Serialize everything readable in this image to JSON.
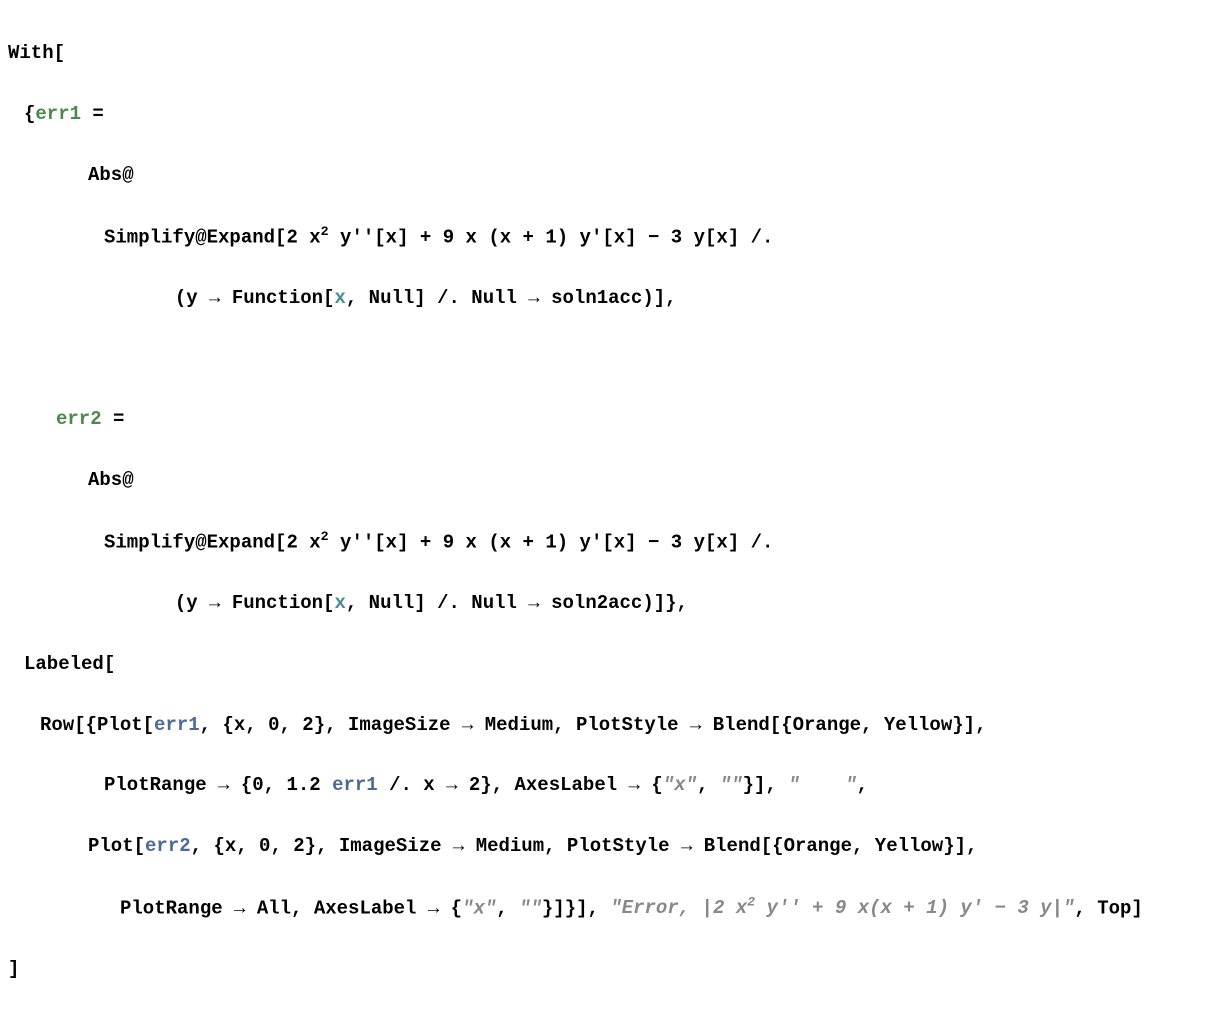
{
  "line1": {
    "p1": "With",
    "p2": "["
  },
  "line2": {
    "p1": "{",
    "var": "err1",
    "op": " ="
  },
  "line3": {
    "p1": "Abs",
    "p2": "@"
  },
  "line4": {
    "p1": "Simplify",
    "p2": "@",
    "p3": "Expand",
    "p4": "[",
    "p5": "2 x",
    "sup1": "2",
    "p6": " y''",
    "p7": "[",
    "p8": "x",
    "p9": "]",
    "p10": " + 9 x ",
    "p11": "(",
    "p12": "x + 1",
    "p13": ")",
    "p14": " y'",
    "p15": "[",
    "p16": "x",
    "p17": "]",
    "p18": " − 3 y",
    "p19": "[",
    "p20": "x",
    "p21": "]",
    "p22": " /."
  },
  "line5": {
    "p1": "(",
    "p2": "y → Function",
    "p3": "[",
    "var": "x",
    "p4": ", Null",
    "p5": "]",
    "p6": " /. Null → soln1acc",
    "p7": ")]",
    "p8": ","
  },
  "line6": {
    "var": "err2",
    "op": " ="
  },
  "line7": {
    "p1": "Abs",
    "p2": "@"
  },
  "line8": {
    "p1": "Simplify",
    "p2": "@",
    "p3": "Expand",
    "p4": "[",
    "p5": "2 x",
    "sup1": "2",
    "p6": " y''",
    "p7": "[",
    "p8": "x",
    "p9": "]",
    "p10": " + 9 x ",
    "p11": "(",
    "p12": "x + 1",
    "p13": ")",
    "p14": " y'",
    "p15": "[",
    "p16": "x",
    "p17": "]",
    "p18": " − 3 y",
    "p19": "[",
    "p20": "x",
    "p21": "]",
    "p22": " /."
  },
  "line9": {
    "p1": "(",
    "p2": "y → Function",
    "p3": "[",
    "var": "x",
    "p4": ", Null",
    "p5": "]",
    "p6": " /. Null → soln2acc",
    "p7": ")]}",
    "p8": ","
  },
  "line10": {
    "p1": "Labeled",
    "p2": "["
  },
  "line11": {
    "p1": "Row",
    "p2": "[{",
    "p3": "Plot",
    "p4": "[",
    "var1": "err1",
    "p5": ", ",
    "p6": "{",
    "p7": "x, 0, 2",
    "p8": "}",
    "p9": ", ImageSize → Medium, PlotStyle → Blend",
    "p10": "[{",
    "p11": "Orange, Yellow",
    "p12": "}]",
    "p13": ","
  },
  "line12": {
    "p1": "PlotRange → ",
    "p2": "{",
    "p3": "0, 1.2 ",
    "var1": "err1",
    "p4": " /. x → 2",
    "p5": "}",
    "p6": ", AxesLabel → ",
    "p7": "{",
    "str1": "\"x\"",
    "p8": ", ",
    "str2": "\"\"",
    "p9": "}]",
    "p10": ", ",
    "str3": "\"    \"",
    "p11": ","
  },
  "line13": {
    "p1": "Plot",
    "p2": "[",
    "var1": "err2",
    "p3": ", ",
    "p4": "{",
    "p5": "x, 0, 2",
    "p6": "}",
    "p7": ", ImageSize → Medium, PlotStyle → Blend",
    "p8": "[{",
    "p9": "Orange, Yellow",
    "p10": "}]",
    "p11": ","
  },
  "line14": {
    "p1": "PlotRange → All, AxesLabel → ",
    "p2": "{",
    "str1": "\"x\"",
    "p3": ", ",
    "str2": "\"\"",
    "p4": "}]}]",
    "p5": ", ",
    "str3a": "\"Error, |2 ",
    "str3b": "x",
    "sup": "2",
    "str3c": " y'' + 9 x(x + 1) y' − 3 y|\"",
    "p6": ", Top",
    "p7": "]"
  },
  "line15": {
    "p1": "]"
  }
}
